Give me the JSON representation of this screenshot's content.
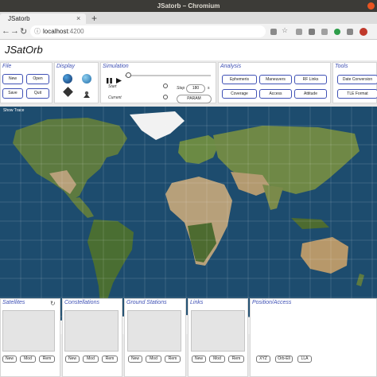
{
  "browser": {
    "window_title": "JSatorb – Chromium",
    "tab_title": "JSatorb",
    "tab_close": "×",
    "new_tab": "+",
    "url_host": "localhost",
    "url_port": ":4200"
  },
  "app": {
    "title": "JSatOrb",
    "file": {
      "title": "File",
      "new": "New",
      "open": "Open",
      "save": "Save",
      "quit": "Quit"
    },
    "display": {
      "title": "Display"
    },
    "simulation": {
      "title": "Simulation",
      "start_label": "Start",
      "current_label": "Current",
      "step_label": "Step",
      "step_value": "180",
      "step_unit": "s",
      "param": "PARAM"
    },
    "analysis": {
      "title": "Analysis",
      "ephemeris": "Ephemeris",
      "maneuvers": "Maneuvers",
      "rf_links": "RF Links",
      "coverage": "Coverage",
      "access": "Access",
      "attitude": "Attitude"
    },
    "tools": {
      "title": "Tools",
      "date_conversion": "Date Conversion",
      "tle_format": "TLE Format"
    },
    "map": {
      "show_trace": "Show Trace"
    },
    "satellites": {
      "title": "Satellites",
      "new": "New",
      "mod": "Mod",
      "rem": "Rem"
    },
    "constellations": {
      "title": "Constellations",
      "new": "New",
      "mod": "Mod",
      "rem": "Rem"
    },
    "ground_stations": {
      "title": "Ground Stations",
      "new": "New",
      "mod": "Mod",
      "rem": "Rem"
    },
    "links": {
      "title": "Links",
      "new": "New",
      "mod": "Mod",
      "rem": "Rem"
    },
    "position_access": {
      "title": "Position/Access",
      "xyz": "XYZ",
      "orb_ell": "Orb-Ell",
      "lla": "LLA"
    }
  },
  "colors": {
    "accent": "#3f51b5",
    "ocean": "#1d4c6e",
    "land": "#5d7a40",
    "desert": "#b7a07a",
    "ice": "#f2f2f2"
  }
}
